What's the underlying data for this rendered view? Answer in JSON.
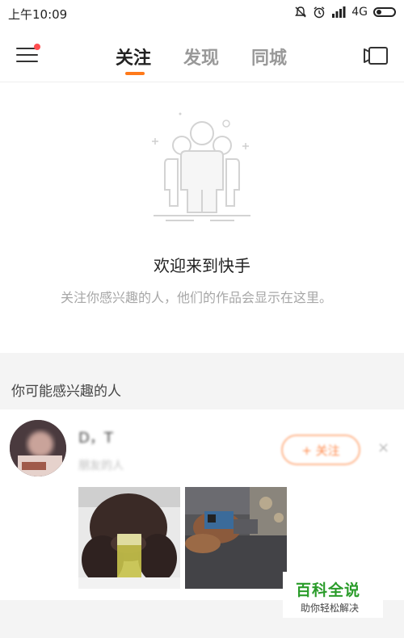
{
  "status_bar": {
    "time": "上午10:09",
    "network": "4G",
    "icons": [
      "bell-off-icon",
      "alarm-icon",
      "signal-icon",
      "battery-icon"
    ]
  },
  "nav": {
    "tabs": [
      {
        "label": "关注",
        "active": true
      },
      {
        "label": "发现",
        "active": false
      },
      {
        "label": "同城",
        "active": false
      }
    ],
    "accent": "#ff7a1a",
    "badge_color": "#ff4d4f"
  },
  "empty_state": {
    "title": "欢迎来到快手",
    "description": "关注你感兴趣的人，他们的作品会显示在这里。"
  },
  "suggestions": {
    "section_title": "你可能感兴趣的人",
    "items": [
      {
        "name": "D，T",
        "subtitle": "朋友的人",
        "follow_label": "+ 关注",
        "dismiss_glyph": "×"
      }
    ]
  },
  "watermark": {
    "title": "百科全说",
    "subtitle": "助你轻松解决",
    "color": "#2a9c2a"
  }
}
